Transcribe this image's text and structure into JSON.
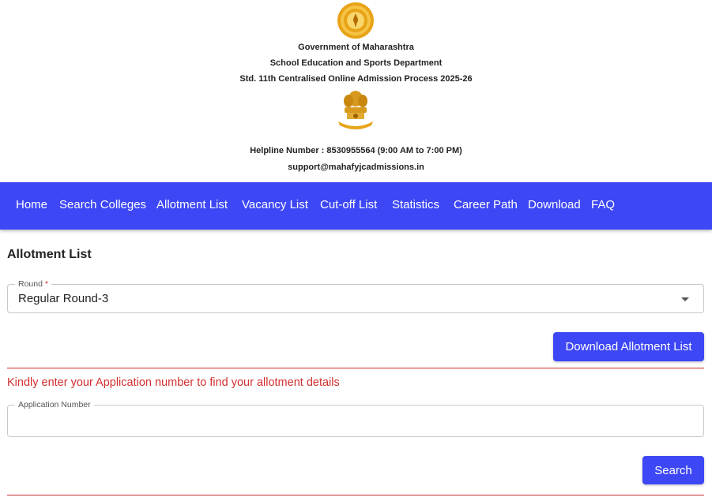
{
  "header": {
    "line1": "Government of Maharashtra",
    "line2": "School Education and Sports Department",
    "line3": "Std. 11th Centralised Online Admission Process 2025-26",
    "helpline": "Helpline Number : 8530955564 (9:00 AM to 7:00 PM)",
    "email": "support@mahafyjcadmissions.in",
    "top_emblem_icon": "maharashtra-seal-icon",
    "mid_emblem_icon": "ashoka-emblem-icon"
  },
  "nav": {
    "items": [
      {
        "label": "Home"
      },
      {
        "label": "Search Colleges"
      },
      {
        "label": "Allotment List"
      },
      {
        "label": "Vacancy List"
      },
      {
        "label": "Cut-off List"
      },
      {
        "label": "Statistics"
      },
      {
        "label": "Career Path"
      },
      {
        "label": "Download"
      },
      {
        "label": "FAQ"
      }
    ],
    "background": "#3d47f5"
  },
  "main": {
    "title": "Allotment List",
    "round": {
      "label": "Round",
      "required_mark": "*",
      "value": "Regular Round-3"
    },
    "download_button": "Download Allotment List",
    "notice": "Kindly enter your Application number to find your allotment details",
    "application": {
      "label": "Application Number",
      "value": ""
    },
    "search_button": "Search"
  },
  "colors": {
    "accent": "#3d47f5",
    "error": "#d32f2f",
    "divider": "#c62828"
  }
}
